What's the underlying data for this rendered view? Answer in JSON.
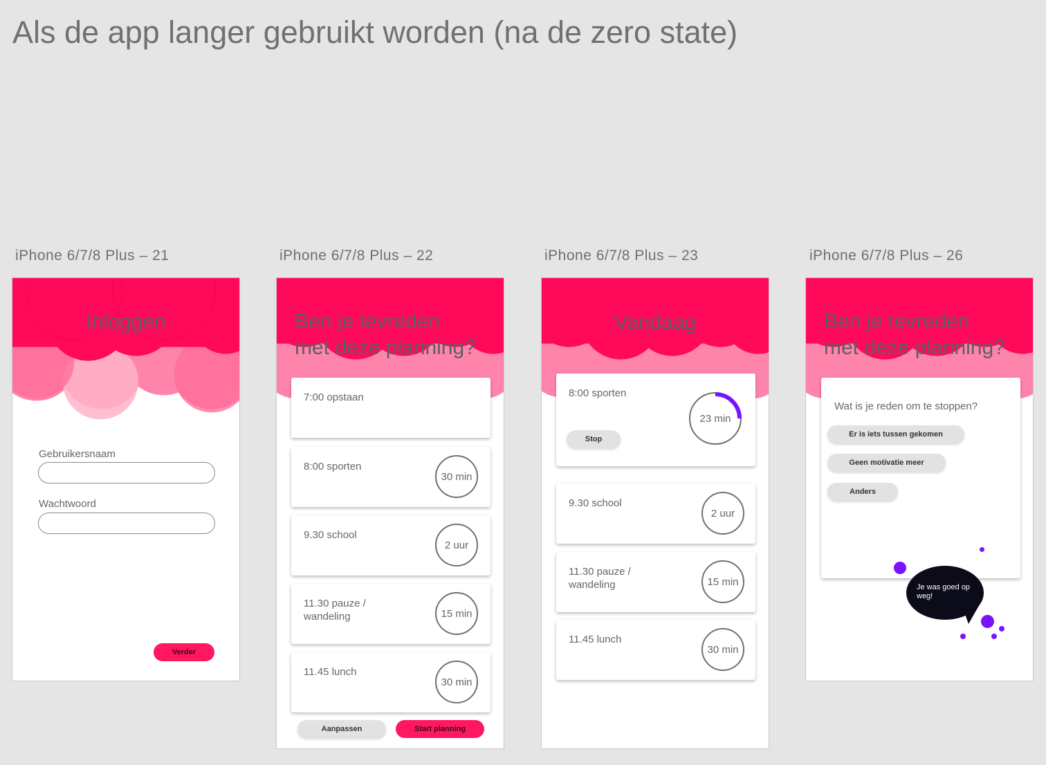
{
  "page_title": "Als de app langer gebruikt worden (na de zero state)",
  "colors": {
    "accent": "#ff175f",
    "header_pink": "#ff0a5a",
    "progress_purple": "#7a12ff",
    "speech_bubble": "#0b0b1a"
  },
  "artboards": {
    "a21": {
      "label": "iPhone 6/7/8 Plus – 21",
      "title": "Inloggen",
      "username_label": "Gebruikersnaam",
      "password_label": "Wachtwoord",
      "username_value": "",
      "password_value": "",
      "next_button": "Verder"
    },
    "a22": {
      "label": "iPhone 6/7/8 Plus – 22",
      "title_line1": "Ben je tevreden",
      "title_line2": "met deze planning?",
      "items": [
        {
          "task": "7:00 opstaan",
          "duration": ""
        },
        {
          "task": "8:00 sporten",
          "duration": "30 min"
        },
        {
          "task": "9.30 school",
          "duration": "2 uur"
        },
        {
          "task": "11.30 pauze / wandeling",
          "duration": "15 min"
        },
        {
          "task": "11.45 lunch",
          "duration": "30 min"
        }
      ],
      "adjust_button": "Aanpassen",
      "start_button": "Start planning"
    },
    "a23": {
      "label": "iPhone 6/7/8 Plus – 23",
      "title": "Vandaag",
      "active": {
        "task": "8:00 sporten",
        "timer": "23 min",
        "progress": 0.25,
        "stop_button": "Stop"
      },
      "items": [
        {
          "task": "9.30 school",
          "duration": "2 uur"
        },
        {
          "task": "11.30 pauze / wandeling",
          "duration": "15 min"
        },
        {
          "task": "11.45 lunch",
          "duration": "30 min"
        }
      ]
    },
    "a26": {
      "label": "iPhone 6/7/8 Plus – 26",
      "title_line1": "Ben je tevreden",
      "title_line2": "met deze planning?",
      "question": "Wat is je reden om te stoppen?",
      "options": [
        "Er is iets tussen gekomen",
        "Geen motivatie meer",
        "Anders"
      ],
      "speech": "Je was goed op weg!"
    }
  }
}
